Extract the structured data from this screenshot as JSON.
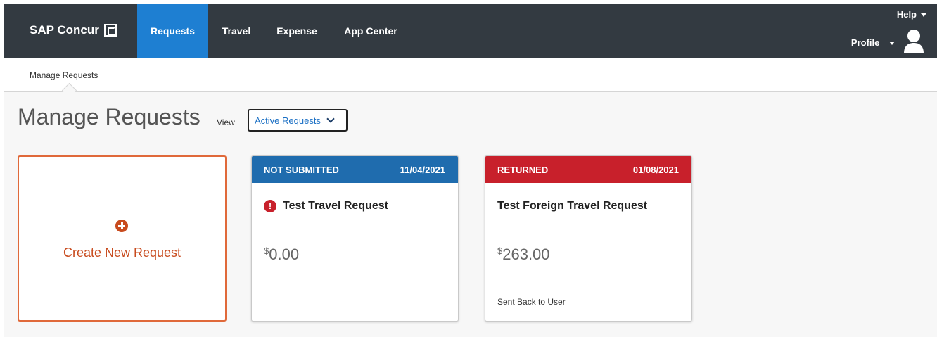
{
  "brand": {
    "name": "SAP Concur",
    "logo_icon": "concur-c-icon"
  },
  "nav": {
    "tabs": [
      {
        "label": "Requests",
        "active": true
      },
      {
        "label": "Travel",
        "active": false
      },
      {
        "label": "Expense",
        "active": false
      },
      {
        "label": "App Center",
        "active": false
      }
    ],
    "help_label": "Help",
    "profile_label": "Profile",
    "accent_color": "#1e7fd2",
    "bar_color": "#333a41"
  },
  "subnav": {
    "items": [
      {
        "label": "Manage Requests"
      }
    ]
  },
  "page": {
    "title": "Manage Requests",
    "view_label": "View",
    "view_selected": "Active Requests"
  },
  "create_card": {
    "label": "Create New Request",
    "color": "#c84b1e"
  },
  "requests": [
    {
      "status": "NOT SUBMITTED",
      "date": "11/04/2021",
      "title": "Test Travel Request",
      "has_alert": true,
      "currency": "$",
      "amount": "0.00",
      "note": "",
      "header_color": "#1f6cae"
    },
    {
      "status": "RETURNED",
      "date": "01/08/2021",
      "title": "Test Foreign Travel Request",
      "has_alert": false,
      "currency": "$",
      "amount": "263.00",
      "note": "Sent Back to User",
      "header_color": "#c8202b"
    }
  ]
}
